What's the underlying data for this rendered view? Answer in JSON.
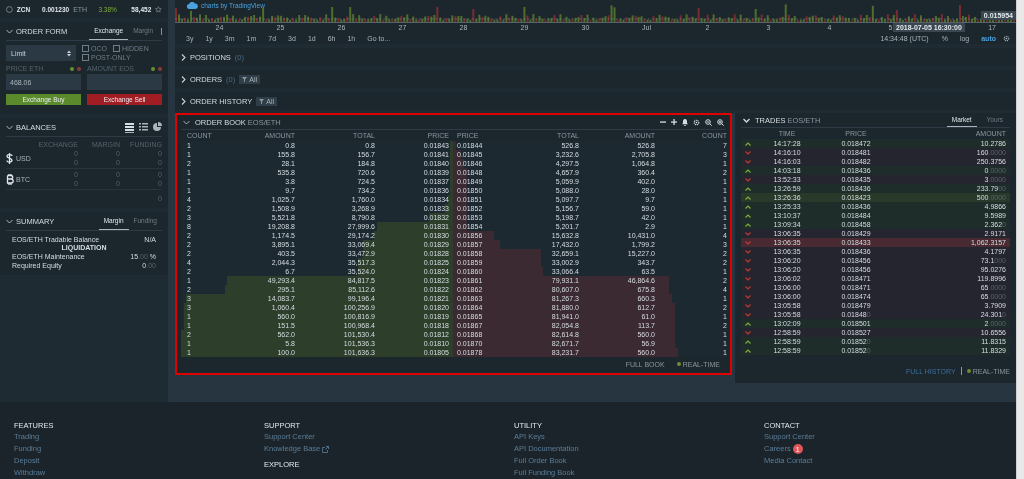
{
  "ticker": {
    "symbol": "ZCN",
    "price": "0.001230",
    "unit": "ETH",
    "change": "3.38%",
    "volume": "58,452"
  },
  "order_form": {
    "title": "ORDER FORM",
    "tabs": [
      {
        "label": "Exchange",
        "selected": true
      },
      {
        "label": "Margin",
        "selected": false
      }
    ],
    "order_type": "Limit",
    "options": [
      {
        "label": "OCO",
        "checked": false
      },
      {
        "label": "HIDDEN",
        "checked": false
      },
      {
        "label": "POST-ONLY",
        "checked": false
      }
    ],
    "price_label": "PRICE ETH",
    "amount_label": "AMOUNT EOS",
    "price_value": "468.06",
    "buy_button": "Exchange Buy",
    "sell_button": "Exchange Sell"
  },
  "balances": {
    "title": "BALANCES",
    "views": [
      {
        "kind": "table",
        "selected": true
      },
      {
        "kind": "list",
        "selected": false
      },
      {
        "kind": "pie",
        "selected": false
      }
    ],
    "columns": [
      "EXCHANGE",
      "MARGIN",
      "FUNDING"
    ],
    "rows": [
      {
        "kind": "usd",
        "currency": "USD",
        "cells": [
          [
            "0",
            "0"
          ],
          [
            "0",
            "0"
          ],
          [
            "0",
            "0"
          ]
        ]
      },
      {
        "kind": "btc",
        "currency": "BTC",
        "cells": [
          [
            "0",
            "0"
          ],
          [
            "0",
            "0"
          ],
          [
            "0",
            "0"
          ]
        ]
      }
    ],
    "total": "0"
  },
  "summary": {
    "title": "SUMMARY",
    "tabs": [
      {
        "label": "Margin",
        "selected": true
      },
      {
        "label": "Funding",
        "selected": false
      }
    ],
    "tradable_label": "EOS/ETH Tradable Balance",
    "tradable_value": "N/A",
    "section": "LIQUIDATION",
    "maintenance_label": "EOS/ETH Maintenance",
    "maintenance_value": "15",
    "maintenance_dim": ".00",
    "maintenance_unit": "%",
    "equity_label": "Required Equity",
    "equity_value": "0",
    "equity_dim": ".00"
  },
  "chart": {
    "brand": "charts by TradingView",
    "x_labels": [
      "24",
      "25",
      "26",
      "27",
      "28",
      "29",
      "30",
      "Jul",
      "2",
      "3",
      "4",
      "5"
    ],
    "last_label": "17",
    "cursor_time": "2018-07-05 16:30:00",
    "last_price": "0.015954",
    "ranges": [
      "3y",
      "1y",
      "3m",
      "1m",
      "7d",
      "3d",
      "1d",
      "6h",
      "1h",
      "Go to..."
    ],
    "clock": "14:34:48 (UTC)",
    "scale_options": [
      {
        "label": "%",
        "selected": false
      },
      {
        "label": "log",
        "selected": false
      },
      {
        "label": "auto",
        "selected": true
      }
    ]
  },
  "panels": [
    {
      "title": "POSITIONS",
      "count": "(0)"
    },
    {
      "title": "ORDERS",
      "count": "(0)",
      "filter": "All"
    },
    {
      "title": "ORDER HISTORY",
      "filter": "All"
    }
  ],
  "order_book": {
    "title": "ORDER BOOK",
    "pair": "EOS/ETH",
    "bid_columns": [
      "COUNT",
      "AMOUNT",
      "TOTAL",
      "PRICE"
    ],
    "ask_columns": [
      "PRICE",
      "TOTAL",
      "AMOUNT",
      "COUNT"
    ],
    "bids": [
      {
        "count": "1",
        "amount": "0.8",
        "total": "0.8",
        "price": "0.01843",
        "level": 0.01
      },
      {
        "count": "1",
        "amount": "155.8",
        "total": "156.7",
        "price": "0.01841",
        "level": 0.01
      },
      {
        "count": "2",
        "amount": "28.1",
        "total": "184.8",
        "price": "0.01840",
        "level": 0.01
      },
      {
        "count": "1",
        "amount": "535.8",
        "total": "720.6",
        "price": "0.01839",
        "level": 0.01
      },
      {
        "count": "1",
        "amount": "3.8",
        "total": "724.5",
        "price": "0.01837",
        "level": 0.01
      },
      {
        "count": "1",
        "amount": "9.7",
        "total": "734.2",
        "price": "0.01836",
        "level": 0.01
      },
      {
        "count": "4",
        "amount": "1,025.7",
        "total": "1,760.0",
        "price": "0.01834",
        "level": 0.02
      },
      {
        "count": "2",
        "amount": "1,508.9",
        "total": "3,268.9",
        "price": "0.01833",
        "level": 0.03
      },
      {
        "count": "3",
        "amount": "5,521.8",
        "total": "8,790.8",
        "price": "0.01832",
        "level": 0.09
      },
      {
        "count": "8",
        "amount": "19,208.8",
        "total": "27,999.6",
        "price": "0.01831",
        "level": 0.28
      },
      {
        "count": "2",
        "amount": "1,174.5",
        "total": "29,174.2",
        "price": "0.01830",
        "level": 0.29
      },
      {
        "count": "2",
        "amount": "3,895.1",
        "total": "33,069.4",
        "price": "0.01829",
        "level": 0.33
      },
      {
        "count": "2",
        "amount": "403.5",
        "total": "33,472.9",
        "price": "0.01828",
        "level": 0.33
      },
      {
        "count": "4",
        "amount": "2,044.3",
        "total": "35,517.3",
        "price": "0.01825",
        "level": 0.35
      },
      {
        "count": "2",
        "amount": "6.7",
        "total": "35,524.0",
        "price": "0.01824",
        "level": 0.35
      },
      {
        "count": "1",
        "amount": "49,293.4",
        "total": "84,817.5",
        "price": "0.01823",
        "level": 0.83
      },
      {
        "count": "2",
        "amount": "295.1",
        "total": "85,112.6",
        "price": "0.01822",
        "level": 0.84
      },
      {
        "count": "3",
        "amount": "14,083.7",
        "total": "99,196.4",
        "price": "0.01821",
        "level": 0.98
      },
      {
        "count": "3",
        "amount": "1,060.4",
        "total": "100,256.9",
        "price": "0.01820",
        "level": 0.99
      },
      {
        "count": "1",
        "amount": "560.0",
        "total": "100,816.9",
        "price": "0.01819",
        "level": 0.99
      },
      {
        "count": "1",
        "amount": "151.5",
        "total": "100,968.4",
        "price": "0.01818",
        "level": 0.99
      },
      {
        "count": "2",
        "amount": "562.0",
        "total": "101,530.4",
        "price": "0.01812",
        "level": 1
      },
      {
        "count": "1",
        "amount": "5.8",
        "total": "101,536.3",
        "price": "0.01810",
        "level": 1
      },
      {
        "count": "1",
        "amount": "100.0",
        "total": "101,636.3",
        "price": "0.01805",
        "level": 1
      }
    ],
    "asks": [
      {
        "price": "0.01844",
        "total": "526.8",
        "amount": "526.8",
        "count": "7",
        "level": 0.01
      },
      {
        "price": "0.01845",
        "total": "3,232.6",
        "amount": "2,705.8",
        "count": "3",
        "level": 0.03
      },
      {
        "price": "0.01846",
        "total": "4,297.5",
        "amount": "1,064.8",
        "count": "1",
        "level": 0.04
      },
      {
        "price": "0.01848",
        "total": "4,657.9",
        "amount": "360.4",
        "count": "2",
        "level": 0.05
      },
      {
        "price": "0.01849",
        "total": "5,059.9",
        "amount": "402.0",
        "count": "1",
        "level": 0.05
      },
      {
        "price": "0.01850",
        "total": "5,088.0",
        "amount": "28.0",
        "count": "1",
        "level": 0.05
      },
      {
        "price": "0.01851",
        "total": "5,097.7",
        "amount": "9.7",
        "count": "1",
        "level": 0.05
      },
      {
        "price": "0.01852",
        "total": "5,156.7",
        "amount": "59.0",
        "count": "1",
        "level": 0.05
      },
      {
        "price": "0.01853",
        "total": "5,198.7",
        "amount": "42.0",
        "count": "1",
        "level": 0.05
      },
      {
        "price": "0.01854",
        "total": "5,201.7",
        "amount": "2.9",
        "count": "1",
        "level": 0.05
      },
      {
        "price": "0.01856",
        "total": "15,632.8",
        "amount": "10,431.0",
        "count": "4",
        "level": 0.15
      },
      {
        "price": "0.01857",
        "total": "17,432.0",
        "amount": "1,799.2",
        "count": "3",
        "level": 0.17
      },
      {
        "price": "0.01858",
        "total": "32,659.1",
        "amount": "15,227.0",
        "count": "2",
        "level": 0.32
      },
      {
        "price": "0.01859",
        "total": "33,002.9",
        "amount": "343.7",
        "count": "2",
        "level": 0.32
      },
      {
        "price": "0.01860",
        "total": "33,066.4",
        "amount": "63.5",
        "count": "1",
        "level": 0.33
      },
      {
        "price": "0.01861",
        "total": "79,931.1",
        "amount": "46,864.6",
        "count": "2",
        "level": 0.79
      },
      {
        "price": "0.01862",
        "total": "80,607.0",
        "amount": "675.8",
        "count": "4",
        "level": 0.79
      },
      {
        "price": "0.01863",
        "total": "81,267.3",
        "amount": "660.3",
        "count": "1",
        "level": 0.8
      },
      {
        "price": "0.01864",
        "total": "81,880.0",
        "amount": "612.7",
        "count": "2",
        "level": 0.81
      },
      {
        "price": "0.01865",
        "total": "81,941.0",
        "amount": "61.0",
        "count": "1",
        "level": 0.81
      },
      {
        "price": "0.01867",
        "total": "82,054.8",
        "amount": "113.7",
        "count": "2",
        "level": 0.81
      },
      {
        "price": "0.01868",
        "total": "82,614.8",
        "amount": "560.0",
        "count": "1",
        "level": 0.81
      },
      {
        "price": "0.01870",
        "total": "82,671.7",
        "amount": "56.9",
        "count": "1",
        "level": 0.81
      },
      {
        "price": "0.01878",
        "total": "83,231.7",
        "amount": "560.0",
        "count": "1",
        "level": 0.82
      }
    ],
    "full_book": "FULL BOOK",
    "realtime": "REAL-TIME"
  },
  "trades": {
    "title": "TRADES",
    "pair": "EOS/ETH",
    "tabs": [
      {
        "label": "Market",
        "selected": true
      },
      {
        "label": "Yours",
        "selected": false
      }
    ],
    "columns": [
      "TIME",
      "PRICE",
      "AMOUNT"
    ],
    "rows": [
      {
        "kind": "buy",
        "highlighted": false,
        "time": "14:17:28",
        "price": "0.018472",
        "amount": "10.2786"
      },
      {
        "kind": "sell",
        "highlighted": false,
        "time": "14:16:10",
        "price": "0.018481",
        "amount": "160",
        "amount_dim": ".0000"
      },
      {
        "kind": "sell",
        "highlighted": false,
        "time": "14:16:03",
        "price": "0.018482",
        "amount": "250.3756"
      },
      {
        "kind": "buy",
        "highlighted": false,
        "time": "14:03:18",
        "price": "0.018436",
        "amount": "0",
        "amount_dim": ".0000"
      },
      {
        "kind": "sell",
        "highlighted": false,
        "time": "13:52:33",
        "price": "0.018435",
        "amount": "3",
        "amount_dim": ".0000"
      },
      {
        "kind": "buy",
        "highlighted": false,
        "time": "13:26:59",
        "price": "0.018436",
        "amount": "233.79",
        "amount_dim": "00"
      },
      {
        "kind": "buy",
        "highlighted": true,
        "time": "13:26:36",
        "price": "0.018423",
        "amount": "500",
        "amount_dim": ".0000"
      },
      {
        "kind": "buy",
        "highlighted": false,
        "time": "13:25:33",
        "price": "0.018436",
        "amount": "4.9866"
      },
      {
        "kind": "buy",
        "highlighted": false,
        "time": "13:10:37",
        "price": "0.018484",
        "amount": "9.5989"
      },
      {
        "kind": "buy",
        "highlighted": false,
        "time": "13:09:34",
        "price": "0.018458",
        "amount": "2.362",
        "amount_dim": "0"
      },
      {
        "kind": "sell",
        "highlighted": false,
        "time": "13:06:35",
        "price": "0.018429",
        "amount": "2.9171"
      },
      {
        "kind": "sell",
        "highlighted": true,
        "time": "13:06:35",
        "price": "0.018433",
        "amount": "1,062.3157"
      },
      {
        "kind": "sell",
        "highlighted": false,
        "time": "13:06:35",
        "price": "0.018436",
        "amount": "4.1797"
      },
      {
        "kind": "sell",
        "highlighted": false,
        "time": "13:06:20",
        "price": "0.018456",
        "amount": "73.1",
        "amount_dim": "000"
      },
      {
        "kind": "sell",
        "highlighted": false,
        "time": "13:06:20",
        "price": "0.018456",
        "amount": "95.0276"
      },
      {
        "kind": "sell",
        "highlighted": false,
        "time": "13:06:02",
        "price": "0.018471",
        "amount": "119.8996"
      },
      {
        "kind": "sell",
        "highlighted": false,
        "time": "13:06:00",
        "price": "0.018471",
        "amount": "65",
        "amount_dim": ".0000"
      },
      {
        "kind": "sell",
        "highlighted": false,
        "time": "13:06:00",
        "price": "0.018474",
        "amount": "65",
        "amount_dim": ".0000"
      },
      {
        "kind": "sell",
        "highlighted": false,
        "time": "13:05:58",
        "price": "0.018479",
        "amount": "3.7909"
      },
      {
        "kind": "sell",
        "highlighted": false,
        "time": "13:05:58",
        "price": "0.01848",
        "price_dim": "0",
        "amount": "24.301",
        "amount_dim": "0"
      },
      {
        "kind": "buy",
        "highlighted": false,
        "time": "13:02:09",
        "price": "0.018501",
        "amount": "2",
        "amount_dim": ".0000"
      },
      {
        "kind": "sell",
        "highlighted": false,
        "time": "12:58:59",
        "price": "0.018527",
        "amount": "10.6556"
      },
      {
        "kind": "buy",
        "highlighted": false,
        "time": "12:58:59",
        "price": "0.01852",
        "price_dim": "0",
        "amount": "11.8315"
      },
      {
        "kind": "buy",
        "highlighted": false,
        "time": "12:58:59",
        "price": "0.01852",
        "price_dim": "0",
        "amount": "11.8329"
      }
    ],
    "full_history": "FULL HISTORY",
    "realtime": "REAL-TIME"
  },
  "footer": {
    "columns": [
      {
        "sections": [
          {
            "title": "FEATURES",
            "links": [
              {
                "kind": "plain",
                "label": "Trading"
              },
              {
                "kind": "plain",
                "label": "Funding"
              },
              {
                "kind": "plain",
                "label": "Deposit"
              },
              {
                "kind": "plain",
                "label": "Withdraw"
              }
            ]
          }
        ]
      },
      {
        "sections": [
          {
            "title": "SUPPORT",
            "links": [
              {
                "kind": "plain",
                "label": "Support Center"
              },
              {
                "kind": "external",
                "label": "Knowledge Base"
              }
            ]
          },
          {
            "title": "EXPLORE"
          }
        ]
      },
      {
        "sections": [
          {
            "title": "UTILITY",
            "links": [
              {
                "kind": "plain",
                "label": "API Keys"
              },
              {
                "kind": "plain",
                "label": "API Documentation"
              },
              {
                "kind": "plain",
                "label": "Full Order Book"
              },
              {
                "kind": "plain",
                "label": "Full Funding Book"
              }
            ]
          }
        ]
      },
      {
        "sections": [
          {
            "title": "CONTACT",
            "links": [
              {
                "kind": "plain",
                "label": "Support Center"
              },
              {
                "kind": "badge",
                "label": "Careers",
                "badge": "1"
              },
              {
                "kind": "plain",
                "label": "Media Contact"
              }
            ]
          }
        ]
      }
    ]
  }
}
